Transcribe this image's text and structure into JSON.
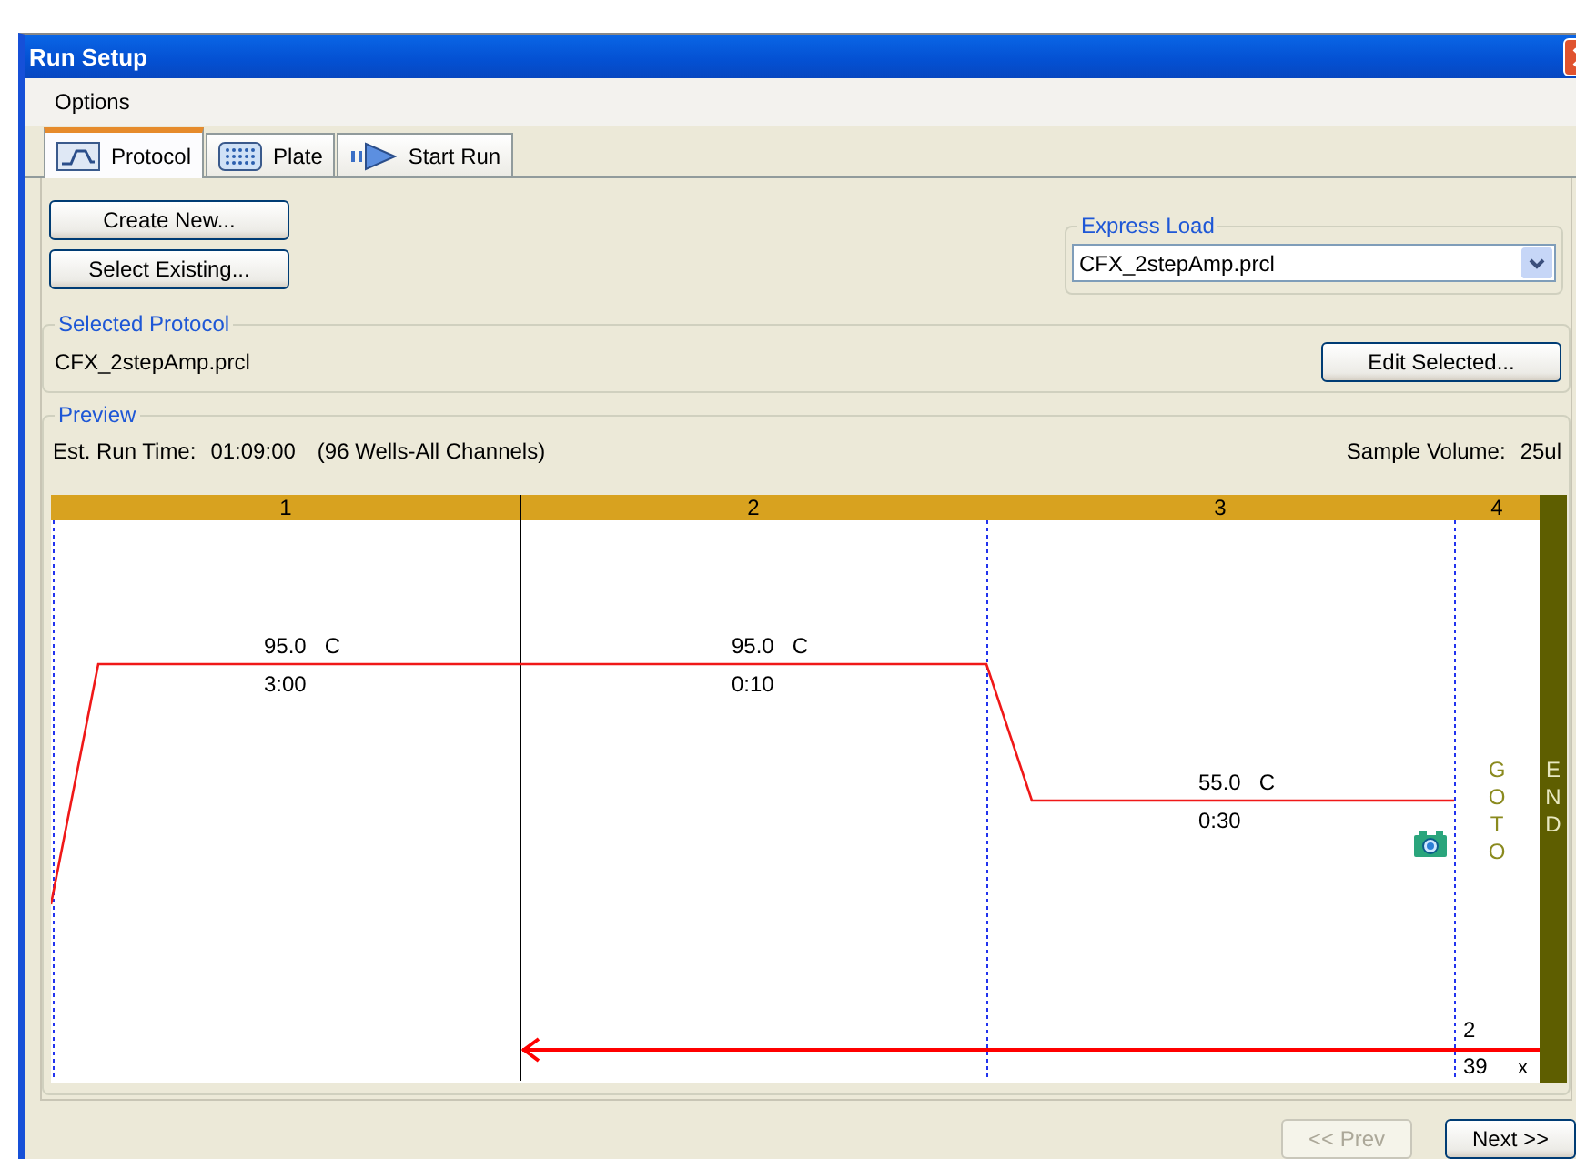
{
  "window": {
    "title": "Run Setup"
  },
  "menu": [
    "Options"
  ],
  "tabs": [
    {
      "label": "Protocol",
      "kind": "protocol",
      "selected": true
    },
    {
      "label": "Plate",
      "kind": "plate",
      "selected": false
    },
    {
      "label": "Start Run",
      "kind": "run",
      "selected": false
    }
  ],
  "protocol_buttons": [
    "Create New...",
    "Select Existing..."
  ],
  "express_load": {
    "label": "Express Load",
    "value": "CFX_2stepAmp.prcl"
  },
  "selected_protocol": {
    "label": "Selected Protocol",
    "file": "CFX_2stepAmp.prcl",
    "edit_button": "Edit Selected..."
  },
  "preview": {
    "label": "Preview",
    "run_time_label": "Est. Run Time:",
    "run_time": "01:09:00",
    "wells": "(96 Wells-All Channels)",
    "sample_volume_label": "Sample Volume:",
    "sample_volume": "25ul"
  },
  "steps": [
    {
      "number": "1",
      "kind": "hold",
      "temperature": "95.0",
      "unit": "C",
      "time": "3:00",
      "plate_read": false
    },
    {
      "number": "2",
      "kind": "hold",
      "temperature": "95.0",
      "unit": "C",
      "time": "0:10",
      "plate_read": false
    },
    {
      "number": "3",
      "kind": "hold",
      "temperature": "55.0",
      "unit": "C",
      "time": "0:30",
      "plate_read": true
    },
    {
      "number": "4",
      "kind": "goto",
      "label": "GOTO",
      "target": "2",
      "repeats": "39",
      "times_mark": "x"
    }
  ],
  "end_label": "END",
  "navigation": {
    "prev": {
      "label": "<< Prev",
      "disabled": true
    },
    "next": {
      "label": "Next >>",
      "disabled": false
    }
  }
}
